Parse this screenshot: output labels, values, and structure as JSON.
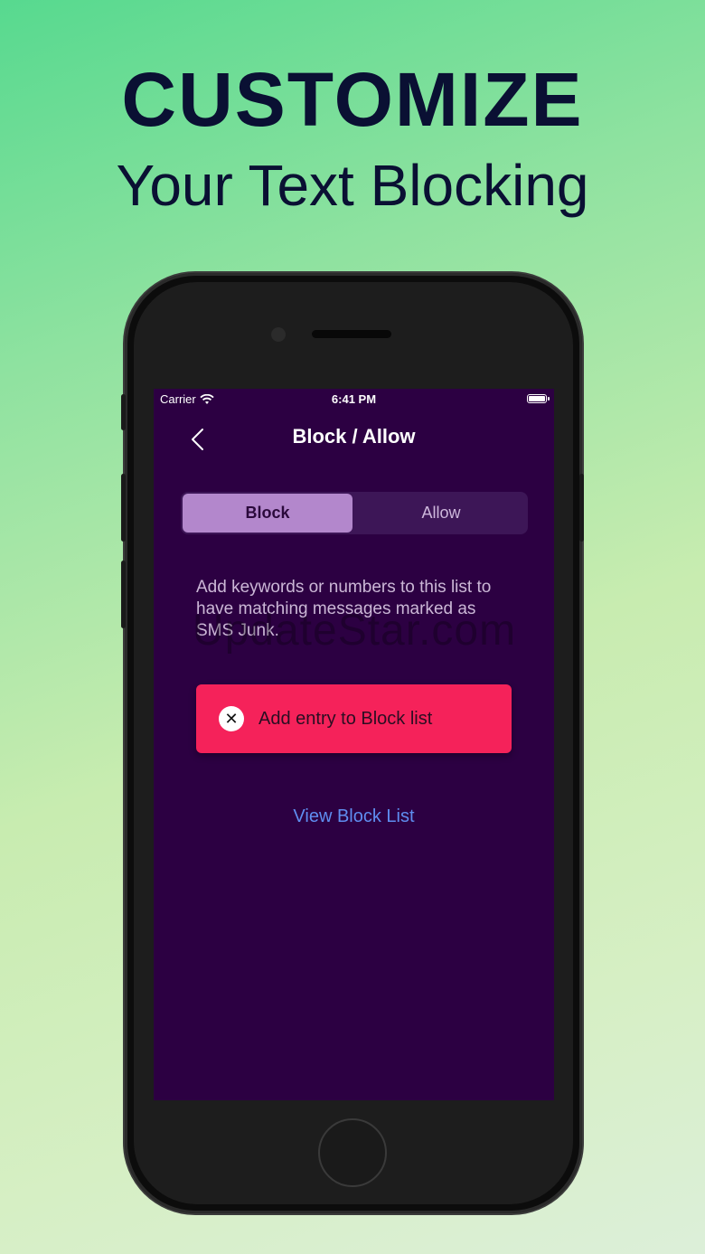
{
  "headline": {
    "title": "CUSTOMIZE",
    "subtitle": "Your Text Blocking"
  },
  "status_bar": {
    "carrier": "Carrier",
    "time": "6:41 PM"
  },
  "nav": {
    "title": "Block / Allow",
    "back_icon": "chevron-left-icon"
  },
  "segmented": {
    "block_label": "Block",
    "allow_label": "Allow",
    "selected": "Block"
  },
  "description": "Add keywords or numbers to this list to have matching messages marked as SMS Junk.",
  "watermark": "UpdateStar.com",
  "add_button": {
    "label": "Add entry to Block list",
    "icon": "close-circle-icon"
  },
  "view_link": "View Block List",
  "colors": {
    "screen_bg": "#2c0042",
    "accent_button": "#f5225a",
    "segment_selected": "#b387cc",
    "link": "#5f8df0",
    "headline": "#0a1033"
  }
}
